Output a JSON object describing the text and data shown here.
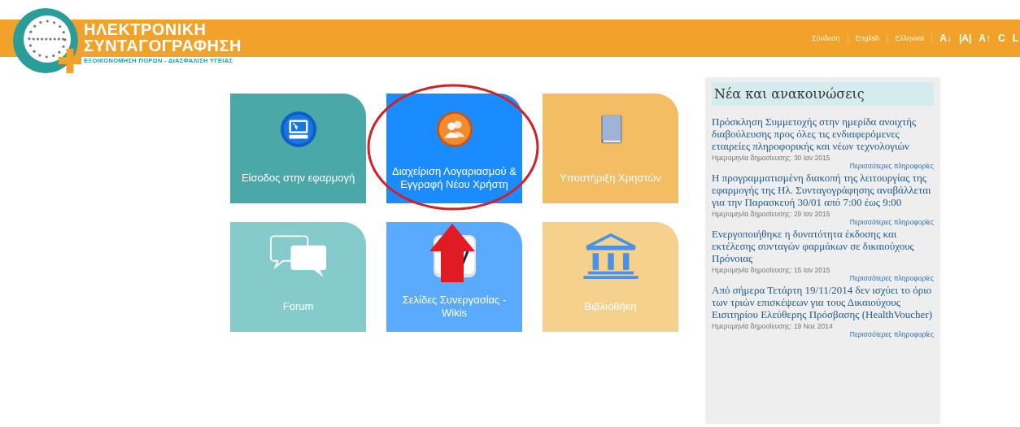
{
  "logo": {
    "line_1": "ΗΛΕΚΤΡΟΝΙΚΗ",
    "line_2": "ΣΥΝΤΑΓΟΓΡΑΦΗΣΗ",
    "tagline": "ΕΞΟΙΚΟΝΟΜΗΣΗ ΠΟΡΩΝ - ΔΙΑΣΦΑΛΙΣΗ ΥΓΕΙΑΣ"
  },
  "top_links": [
    {
      "label": "Σύνδεση",
      "kind": "text"
    },
    {
      "label": "English",
      "kind": "text"
    },
    {
      "label": "Ελληνικά",
      "kind": "text"
    },
    {
      "label": "A↓",
      "kind": "size"
    },
    {
      "label": "|A|",
      "kind": "size"
    },
    {
      "label": "A↑",
      "kind": "size"
    },
    {
      "label": "C",
      "kind": "size"
    },
    {
      "label": "L",
      "kind": "size"
    }
  ],
  "tiles": [
    {
      "label": "Είσοδος στην εφαρμογή",
      "kind": "monitor",
      "color": "#4aa9a8",
      "highlighted": false
    },
    {
      "label": "Διαχείριση Λογαριασμού & Εγγραφή Νέου Χρήστη",
      "kind": "users",
      "color": "#1a8cff",
      "highlighted": true
    },
    {
      "label": "Υποστήριξη Χρηστών",
      "kind": "book",
      "color": "#f2bd63",
      "highlighted": false
    },
    {
      "label": "Forum",
      "kind": "chat",
      "color": "#85cbcc",
      "highlighted": false
    },
    {
      "label": "Σελίδες Συνεργασίας - Wikis",
      "kind": "wiki",
      "color": "#5aabff",
      "highlighted": false
    },
    {
      "label": "Βιβλιοθήκη",
      "kind": "library",
      "color": "#f5d18c",
      "highlighted": false
    }
  ],
  "news": {
    "title": "Νέα και ανακοινώσεις",
    "items": [
      {
        "headline": "Πρόσκληση Συμμετοχής στην ημερίδα ανοιχτής διαβούλευσης προς όλες τις ενδιαφερόμενες εταιρείες πληροφορικής και νέων τεχνολογιών",
        "date": "Ημερομηνία δημοσίευσης: 30 Ιαν 2015",
        "more": "Περισσότερες πληροφορίες"
      },
      {
        "headline": "Η προγραμματισμένη διακοπή της λειτουργίας της εφαρμογής της Ηλ. Συνταγογράφησης αναβάλλεται για την Παρασκευή 30/01 από 7:00 έως 9:00",
        "date": "Ημερομηνία δημοσίευσης: 29 Ιαν 2015",
        "more": "Περισσότερες πληροφορίες"
      },
      {
        "headline": "Ενεργοποιήθηκε η δυνατότητα έκδοσης και εκτέλεσης συνταγών φαρμάκων σε δικαιούχους Πρόνοιας",
        "date": "Ημερομηνία δημοσίευσης: 15 Ιαν 2015",
        "more": "Περισσότερες πληροφορίες"
      },
      {
        "headline": "Από σήμερα Τετάρτη 19/11/2014 δεν ισχύει το όριο των τριών επισκέψεων για τους Δικαιούχους Εισιτηρίου Ελεύθερης Πρόσβασης (HealthVoucher)",
        "date": "Ημερομηνία δημοσίευσης: 19 Νοε 2014",
        "more": "Περισσότερες πληροφορίες"
      }
    ]
  }
}
